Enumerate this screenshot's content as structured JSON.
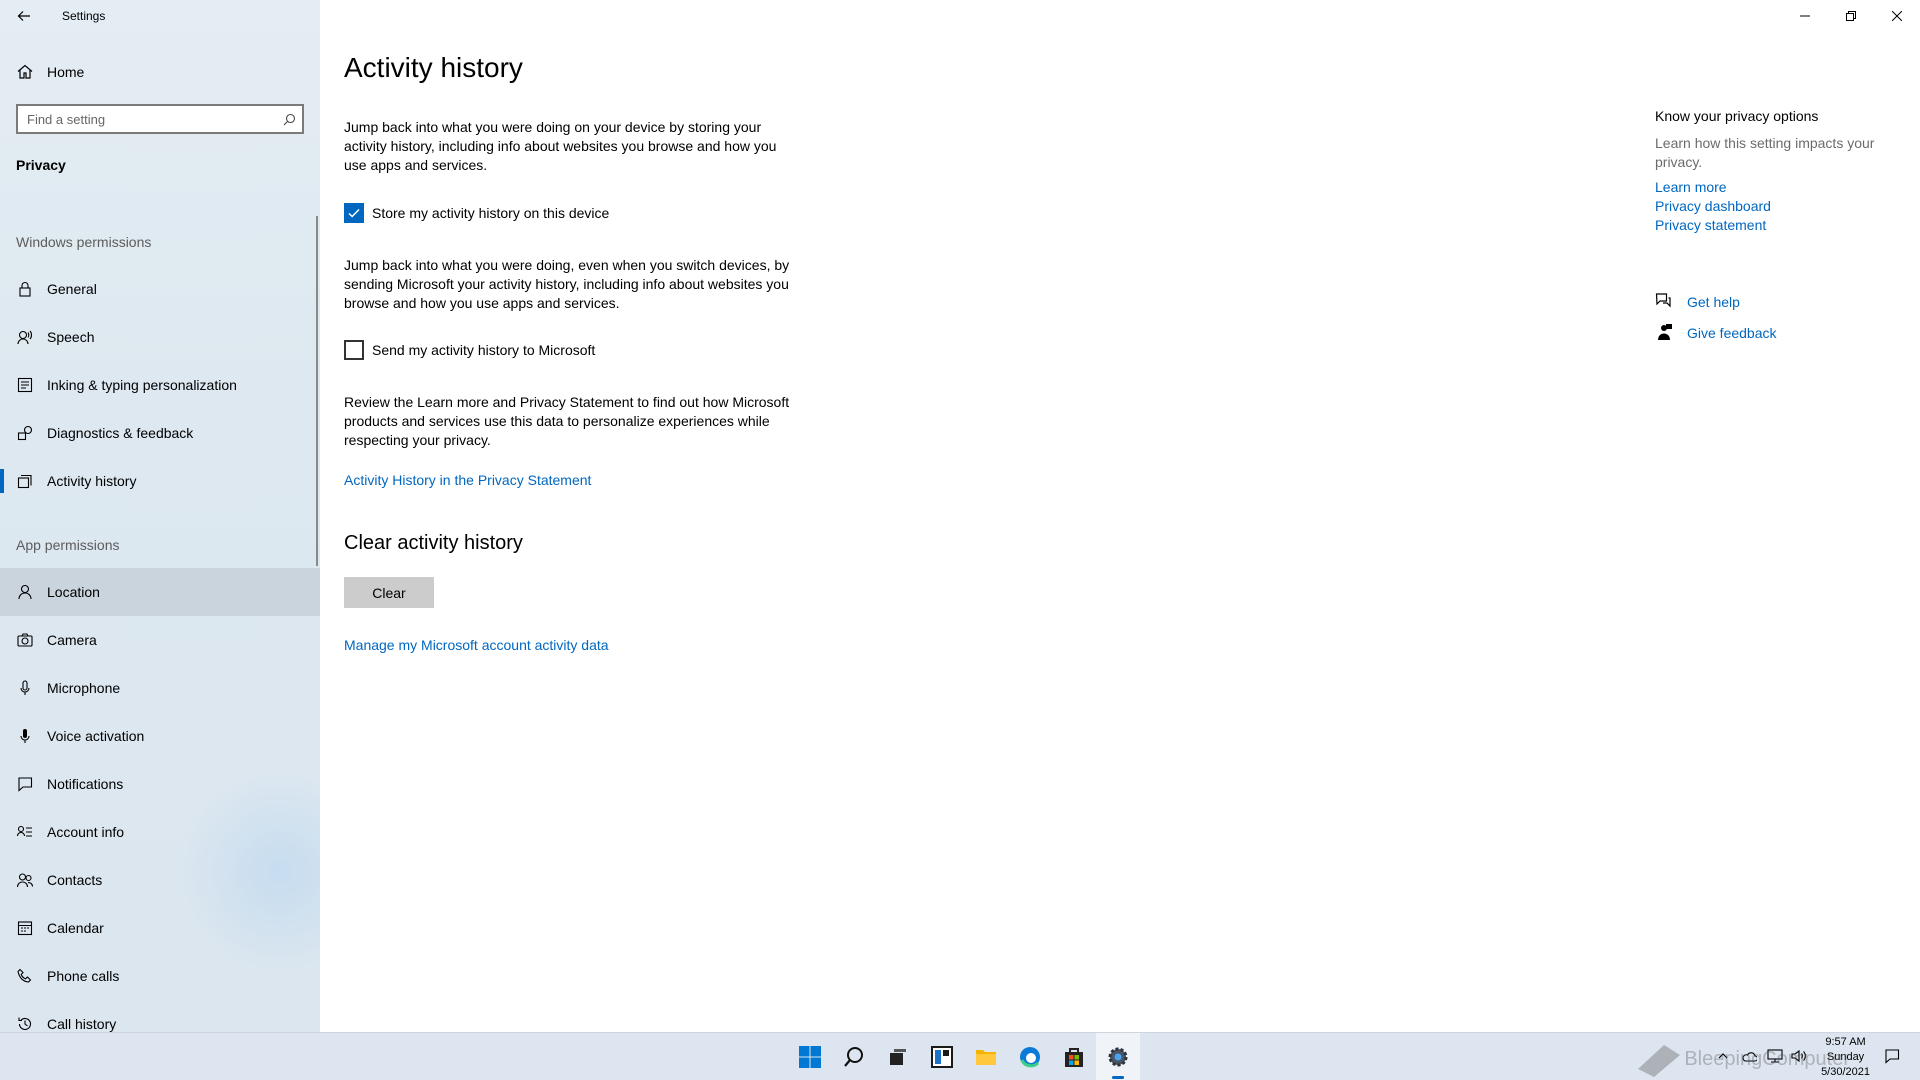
{
  "app": {
    "title": "Settings"
  },
  "sidebar": {
    "home_label": "Home",
    "search_placeholder": "Find a setting",
    "section_title": "Privacy",
    "windows_permissions_label": "Windows permissions",
    "windows_items": [
      {
        "label": "General",
        "icon": "lock-icon"
      },
      {
        "label": "Speech",
        "icon": "speech-icon"
      },
      {
        "label": "Inking & typing personalization",
        "icon": "inking-icon"
      },
      {
        "label": "Diagnostics & feedback",
        "icon": "diagnostics-icon"
      },
      {
        "label": "Activity history",
        "icon": "activity-history-icon",
        "selected": true
      }
    ],
    "app_permissions_label": "App permissions",
    "app_items": [
      {
        "label": "Location",
        "icon": "location-icon",
        "hover": true
      },
      {
        "label": "Camera",
        "icon": "camera-icon"
      },
      {
        "label": "Microphone",
        "icon": "microphone-icon"
      },
      {
        "label": "Voice activation",
        "icon": "voice-activation-icon"
      },
      {
        "label": "Notifications",
        "icon": "notifications-icon"
      },
      {
        "label": "Account info",
        "icon": "account-info-icon"
      },
      {
        "label": "Contacts",
        "icon": "contacts-icon"
      },
      {
        "label": "Calendar",
        "icon": "calendar-icon"
      },
      {
        "label": "Phone calls",
        "icon": "phone-icon"
      },
      {
        "label": "Call history",
        "icon": "call-history-icon"
      }
    ]
  },
  "main": {
    "title": "Activity history",
    "para1": "Jump back into what you were doing on your device by storing your activity history, including info about websites you browse and how you use apps and services.",
    "checkbox1": {
      "label": "Store my activity history on this device",
      "checked": true
    },
    "para2": "Jump back into what you were doing, even when you switch devices, by sending Microsoft your activity history, including info about websites you browse and how you use apps and services.",
    "checkbox2": {
      "label": "Send my activity history to Microsoft",
      "checked": false
    },
    "para3": "Review the Learn more and Privacy Statement to find out how Microsoft products and services use this data to personalize experiences while respecting your privacy.",
    "privacy_link": "Activity History in the Privacy Statement",
    "clear_title": "Clear activity history",
    "clear_button": "Clear",
    "manage_link": "Manage my Microsoft account activity data"
  },
  "aside": {
    "heading": "Know your privacy options",
    "description": "Learn how this setting impacts your privacy.",
    "links": [
      "Learn more",
      "Privacy dashboard",
      "Privacy statement"
    ],
    "get_help": "Get help",
    "give_feedback": "Give feedback"
  },
  "taskbar": {
    "time": "9:57 AM",
    "day": "Sunday",
    "date": "5/30/2021",
    "watermark": "BleepingComputer"
  },
  "colors": {
    "accent": "#0067c0",
    "sidebar_bg": "#dde8f0"
  }
}
